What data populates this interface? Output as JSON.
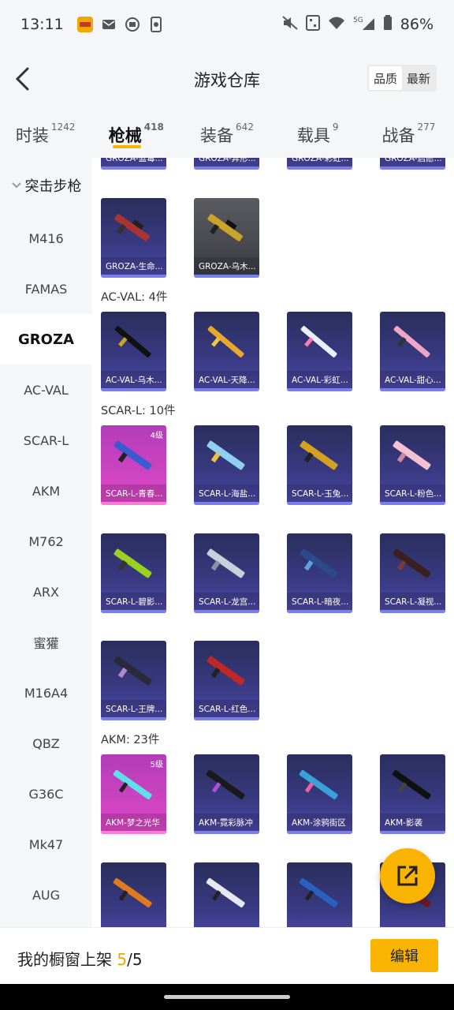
{
  "status": {
    "time": "13:11",
    "battery": "86%",
    "net": "5G"
  },
  "header": {
    "title": "游戏仓库",
    "sort": [
      "品质",
      "最新"
    ]
  },
  "tabs": [
    {
      "label": "时装",
      "count": "1242"
    },
    {
      "label": "枪械",
      "count": "418"
    },
    {
      "label": "装备",
      "count": "642"
    },
    {
      "label": "载具",
      "count": "9"
    },
    {
      "label": "战备",
      "count": "277"
    }
  ],
  "sidebar": {
    "category": "突击步枪",
    "items": [
      "M416",
      "FAMAS",
      "GROZA",
      "AC-VAL",
      "SCAR-L",
      "AKM",
      "M762",
      "ARX",
      "蜜獾",
      "M16A4",
      "QBZ",
      "G36C",
      "Mk47",
      "AUG"
    ]
  },
  "sections": [
    {
      "title": "AC-VAL: 4件"
    },
    {
      "title": "SCAR-L: 10件"
    },
    {
      "title": "AKM: 23件"
    }
  ],
  "cards": {
    "top_partial": [
      "GROZA-蓝毒...",
      "GROZA-异形...",
      "GROZA-彩虹...",
      "GROZA-启愿..."
    ],
    "groza": [
      "GROZA-生命...",
      "GROZA-乌木..."
    ],
    "acval": [
      "AC-VAL-乌木...",
      "AC-VAL-天降...",
      "AC-VAL-彩虹...",
      "AC-VAL-甜心..."
    ],
    "scar": [
      "SCAR-L-青春...",
      "SCAR-L-海盐...",
      "SCAR-L-玉兔...",
      "SCAR-L-粉色...",
      "SCAR-L-碧影...",
      "SCAR-L-龙宫...",
      "SCAR-L-暗夜...",
      "SCAR-L-凝视...",
      "SCAR-L-王牌...",
      "SCAR-L-红色..."
    ],
    "akm": [
      "AKM-梦之光华",
      "AKM-霓彩脉冲",
      "AKM-涂鸦街区",
      "AKM-影袭"
    ],
    "levels": {
      "scar0": "4级",
      "akm0": "5级"
    }
  },
  "footer": {
    "label": "我的橱窗上架 ",
    "current": "5",
    "sep": "/",
    "total": "5",
    "edit": "编辑"
  }
}
